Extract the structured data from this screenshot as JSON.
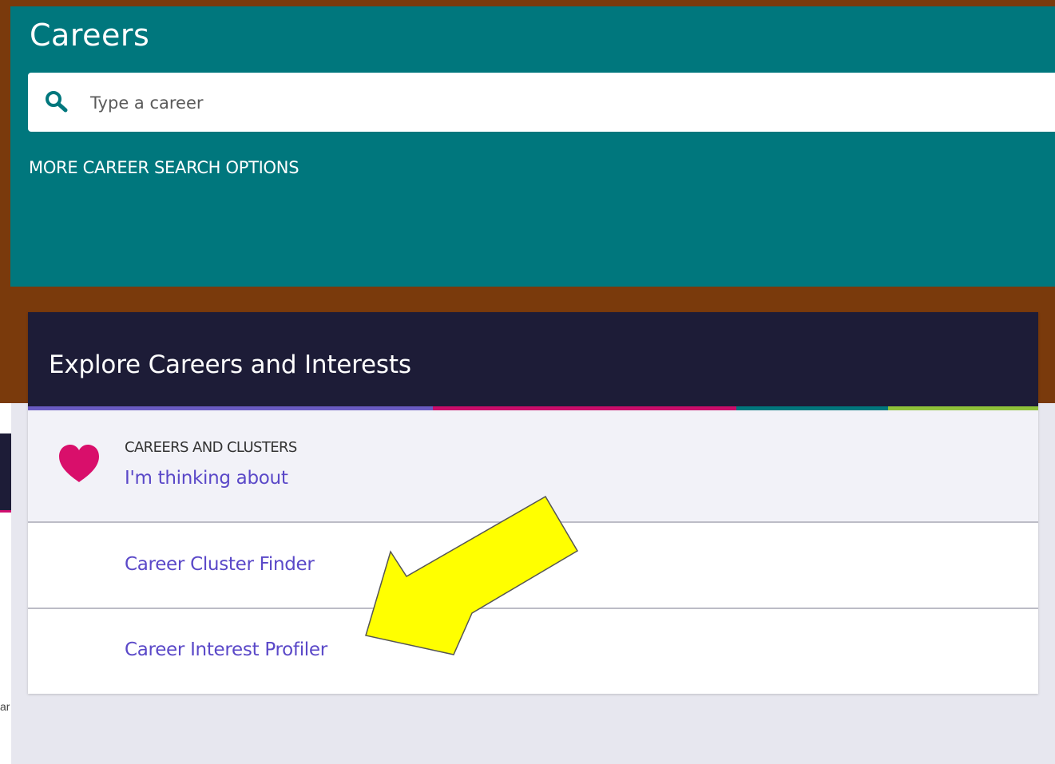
{
  "page": {
    "title": "Careers",
    "search": {
      "placeholder": "Type a career",
      "value": ""
    },
    "more_options_label": "MORE CAREER SEARCH OPTIONS"
  },
  "explore_card": {
    "title": "Explore Careers and Interests",
    "accent_colors": [
      "#6a5bc2",
      "#c90d6a",
      "#00777d",
      "#8fc23a"
    ],
    "items": [
      {
        "eyebrow": "CAREERS AND CLUSTERS",
        "label": "I'm thinking about",
        "icon": "heart-icon"
      },
      {
        "label": "Career Cluster Finder"
      },
      {
        "label": "Career Interest Profiler"
      }
    ]
  },
  "background_fragment": {
    "text": "ar"
  },
  "annotation": {
    "type": "arrow",
    "color": "#ffff00",
    "points_to": "Career Interest Profiler"
  },
  "colors": {
    "header_bg": "#00777d",
    "card_header_bg": "#1d1c37",
    "link": "#5a48c8",
    "heart": "#d90f6b",
    "frame": "#7a3a0c",
    "page_bg": "#e7e7ef"
  }
}
